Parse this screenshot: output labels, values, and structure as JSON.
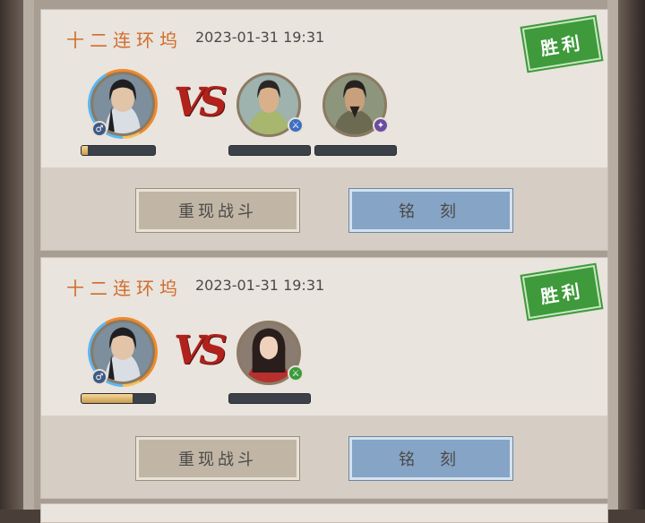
{
  "battles": [
    {
      "title": "十二连环坞",
      "time": "2023-01-31  19:31",
      "result": "胜利",
      "vs": "VS",
      "player": {
        "name": "player-hero",
        "progress": 0.08
      },
      "enemies": [
        {
          "name": "enemy-1",
          "badge_color": "#3d6fc4"
        },
        {
          "name": "enemy-2",
          "badge_color": "#6a4ca3"
        }
      ],
      "replay_label": "重现战斗",
      "engrave_label": "铭刻"
    },
    {
      "title": "十二连环坞",
      "time": "2023-01-31  19:31",
      "result": "胜利",
      "vs": "VS",
      "player": {
        "name": "player-hero",
        "progress": 0.7
      },
      "enemies": [
        {
          "name": "enemy-1",
          "badge_color": "#3a9a3a"
        }
      ],
      "replay_label": "重现战斗",
      "engrave_label": "铭刻"
    }
  ],
  "colors": {
    "title": "#d06d2b",
    "stamp": "#3e9a3a",
    "vs": "#b0221b"
  }
}
